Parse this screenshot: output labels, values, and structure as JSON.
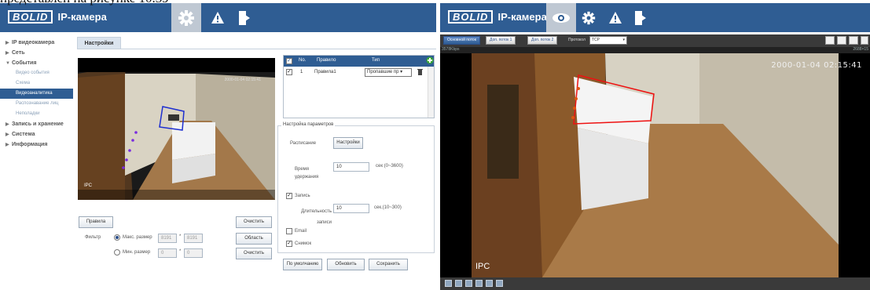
{
  "caption": "представлен на рисунке 10.39",
  "left": {
    "brand": {
      "logo": "BOLID",
      "product": "IP-камера"
    },
    "tab": "Настройки",
    "sidebar": [
      {
        "type": "group",
        "label": "IP видеокамера",
        "expanded": false
      },
      {
        "type": "group",
        "label": "Сеть",
        "expanded": false
      },
      {
        "type": "group",
        "label": "События",
        "expanded": true
      },
      {
        "type": "sub",
        "label": "Видео события"
      },
      {
        "type": "sub",
        "label": "Схема"
      },
      {
        "type": "sub",
        "label": "Видеоаналитика",
        "active": true
      },
      {
        "type": "sub",
        "label": "Распознавание лиц"
      },
      {
        "type": "sub",
        "label": "Неполадки"
      },
      {
        "type": "group",
        "label": "Запись и хранение",
        "expanded": false
      },
      {
        "type": "group",
        "label": "Система",
        "expanded": false
      },
      {
        "type": "group",
        "label": "Информация",
        "expanded": false
      }
    ],
    "video": {
      "timestamp": "2000-01-04 02:15:41",
      "osd": "IPC"
    },
    "buttons": {
      "rules": "Правила",
      "clear1": "Очистить",
      "area": "Область",
      "clear2": "Очистить",
      "defaults": "По умолчанию",
      "refresh": "Обновить",
      "save": "Сохранить",
      "schedule_settings": "Настройки"
    },
    "filter": {
      "label": "Фильтр",
      "max_label": "Макс. размер",
      "max_w": "8191",
      "max_h": "8191",
      "min_label": "Мин. размер",
      "min_w": "0",
      "min_h": "0",
      "sep": "*"
    },
    "table": {
      "headers": {
        "no": "No.",
        "rule": "Правило",
        "type": "Тип"
      },
      "rows": [
        {
          "no": "1",
          "rule": "Правила1",
          "type": "Пропавшие пр"
        }
      ]
    },
    "params": {
      "legend": "Настройка параметров",
      "schedule_label": "Расписание",
      "hold_label": "Время удержания",
      "hold_value": "10",
      "hold_hint": "сек (0~3600)",
      "record_label": "Запись",
      "duration_label": "Длительность записи",
      "duration_value": "10",
      "duration_hint": "сек.(10~300)",
      "email_label": "Email",
      "snapshot_label": "Снимок"
    },
    "colors": {
      "header": "#2f5d93",
      "active": "#2f5d93"
    }
  },
  "right": {
    "brand": {
      "logo": "BOLID",
      "product": "IP-камера"
    },
    "stream_tabs": [
      "Основной поток",
      "Доп. поток 1",
      "Доп. поток 2"
    ],
    "protocol_label": "Протокол",
    "protocol_value": "TCP",
    "rate_left": "3578Kbps",
    "rate_right": "2688×15",
    "video": {
      "timestamp": "2000-01-04 02:15:41",
      "osd": "IPC"
    }
  }
}
